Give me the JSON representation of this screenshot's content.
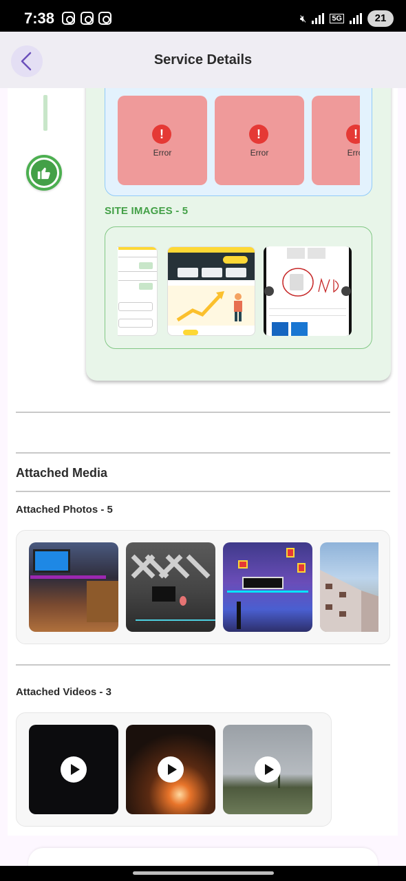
{
  "status_bar": {
    "time": "7:38",
    "network_label": "5G",
    "battery_level": "21"
  },
  "app_bar": {
    "title": "Service Details",
    "back_icon": "chevron-left-icon"
  },
  "timeline": {
    "status_icon": "thumbs-up-icon",
    "color": "#43a047"
  },
  "error_images": {
    "tiles": [
      {
        "label": "Error"
      },
      {
        "label": "Error"
      },
      {
        "label": "Error"
      }
    ],
    "icon": "error-icon"
  },
  "site_images": {
    "title": "SITE IMAGES - 5",
    "thumbnails": [
      "site-screenshot-form",
      "site-screenshot-work-summary",
      "site-screenshot-annotated"
    ]
  },
  "attached_media": {
    "heading": "Attached Media",
    "photos": {
      "heading": "Attached Photos - 5",
      "items": [
        "photo-desk-setup-wood",
        "photo-gaming-room-dark",
        "photo-neon-desk-setup",
        "photo-building"
      ]
    },
    "videos": {
      "heading": "Attached Videos - 3",
      "items": [
        "video-dark",
        "video-night-fire",
        "video-field-rain"
      ],
      "play_icon": "play-icon"
    }
  },
  "colors": {
    "accent": "#6b4fbb",
    "success": "#4caf50",
    "error": "#e53935",
    "error_tile": "#ef9a9a"
  }
}
